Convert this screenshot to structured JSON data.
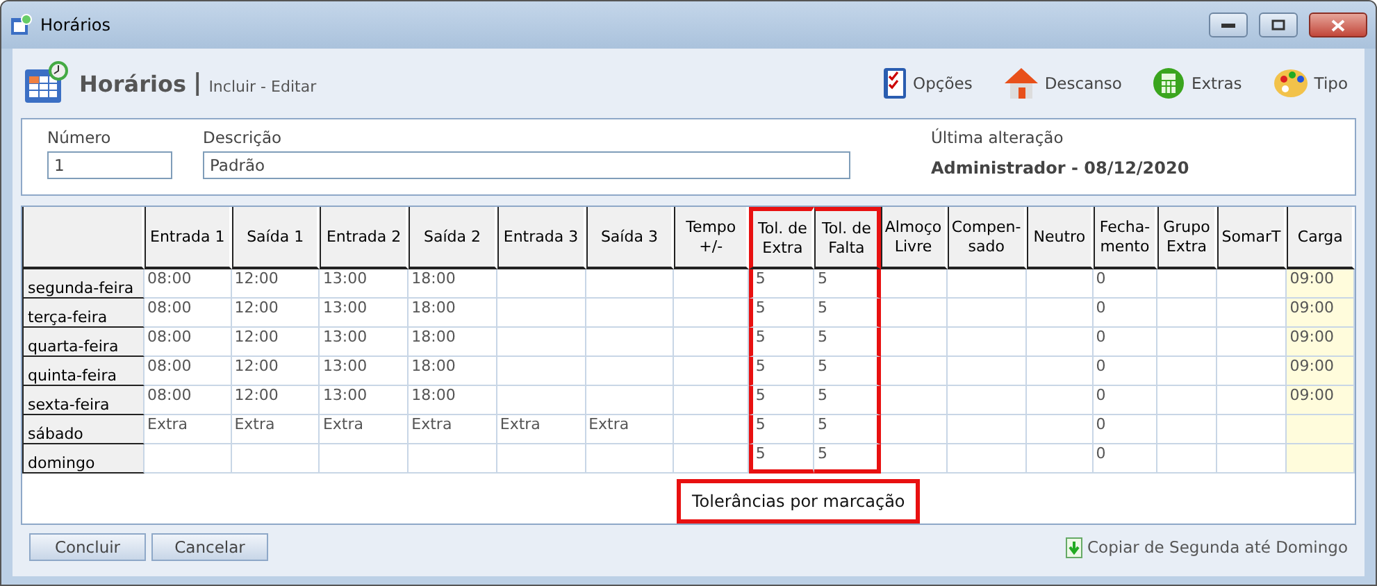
{
  "window": {
    "title": "Horários"
  },
  "header": {
    "title": "Horários",
    "separator": "|",
    "subtitle": "Incluir - Editar"
  },
  "toolbar": [
    {
      "label": "Opções",
      "kind": "checklist"
    },
    {
      "label": "Descanso",
      "kind": "house"
    },
    {
      "label": "Extras",
      "kind": "calculator"
    },
    {
      "label": "Tipo",
      "kind": "palette"
    }
  ],
  "form": {
    "number": {
      "label": "Número",
      "value": "1"
    },
    "description": {
      "label": "Descrição",
      "value": "Padrão"
    },
    "last_change": {
      "label": "Última alteração",
      "value": "Administrador - 08/12/2020"
    }
  },
  "table": {
    "columns": [
      {
        "label": "Entrada 1",
        "kind": "time",
        "highlighted": false
      },
      {
        "label": "Saída 1",
        "kind": "time",
        "highlighted": false
      },
      {
        "label": "Entrada 2",
        "kind": "time",
        "highlighted": false
      },
      {
        "label": "Saída 2",
        "kind": "time",
        "highlighted": false
      },
      {
        "label": "Entrada 3",
        "kind": "time",
        "highlighted": false
      },
      {
        "label": "Saída 3",
        "kind": "time",
        "highlighted": false
      },
      {
        "label": "Tempo\n+/-",
        "kind": "time",
        "highlighted": false
      },
      {
        "label": "Tol. de\nExtra",
        "kind": "time",
        "highlighted": true
      },
      {
        "label": "Tol. de\nFalta",
        "kind": "time",
        "highlighted": true
      },
      {
        "label": "Almoço\nLivre",
        "kind": "time",
        "highlighted": false
      },
      {
        "label": "Compen-\nsado",
        "kind": "time",
        "highlighted": false
      },
      {
        "label": "Neutro",
        "kind": "time",
        "highlighted": false
      },
      {
        "label": "Fecha-\nmento",
        "kind": "time",
        "highlighted": false
      },
      {
        "label": "Grupo\nExtra",
        "kind": "time",
        "highlighted": false
      },
      {
        "label": "SomarT",
        "kind": "time",
        "highlighted": false
      },
      {
        "label": "Carga",
        "kind": "total",
        "highlighted": false
      }
    ],
    "rows": [
      {
        "day": "segunda-feira",
        "cells": [
          "08:00",
          "12:00",
          "13:00",
          "18:00",
          null,
          null,
          null,
          "5",
          "5",
          null,
          null,
          null,
          "0",
          null,
          null,
          "09:00"
        ]
      },
      {
        "day": "terça-feira",
        "cells": [
          "08:00",
          "12:00",
          "13:00",
          "18:00",
          null,
          null,
          null,
          "5",
          "5",
          null,
          null,
          null,
          "0",
          null,
          null,
          "09:00"
        ]
      },
      {
        "day": "quarta-feira",
        "cells": [
          "08:00",
          "12:00",
          "13:00",
          "18:00",
          null,
          null,
          null,
          "5",
          "5",
          null,
          null,
          null,
          "0",
          null,
          null,
          "09:00"
        ]
      },
      {
        "day": "quinta-feira",
        "cells": [
          "08:00",
          "12:00",
          "13:00",
          "18:00",
          null,
          null,
          null,
          "5",
          "5",
          null,
          null,
          null,
          "0",
          null,
          null,
          "09:00"
        ]
      },
      {
        "day": "sexta-feira",
        "cells": [
          "08:00",
          "12:00",
          "13:00",
          "18:00",
          null,
          null,
          null,
          "5",
          "5",
          null,
          null,
          null,
          "0",
          null,
          null,
          "09:00"
        ]
      },
      {
        "day": "sábado",
        "cells": [
          "Extra",
          "Extra",
          "Extra",
          "Extra",
          "Extra",
          "Extra",
          null,
          "5",
          "5",
          null,
          null,
          null,
          "0",
          null,
          null,
          null
        ]
      },
      {
        "day": "domingo",
        "cells": [
          null,
          null,
          null,
          null,
          null,
          null,
          null,
          "5",
          "5",
          null,
          null,
          null,
          "0",
          null,
          null,
          null
        ]
      }
    ]
  },
  "callout": "Tolerâncias por marcação",
  "buttons": [
    "Concluir",
    "Cancelar"
  ],
  "copy_link": "Copiar de Segunda até Domingo"
}
